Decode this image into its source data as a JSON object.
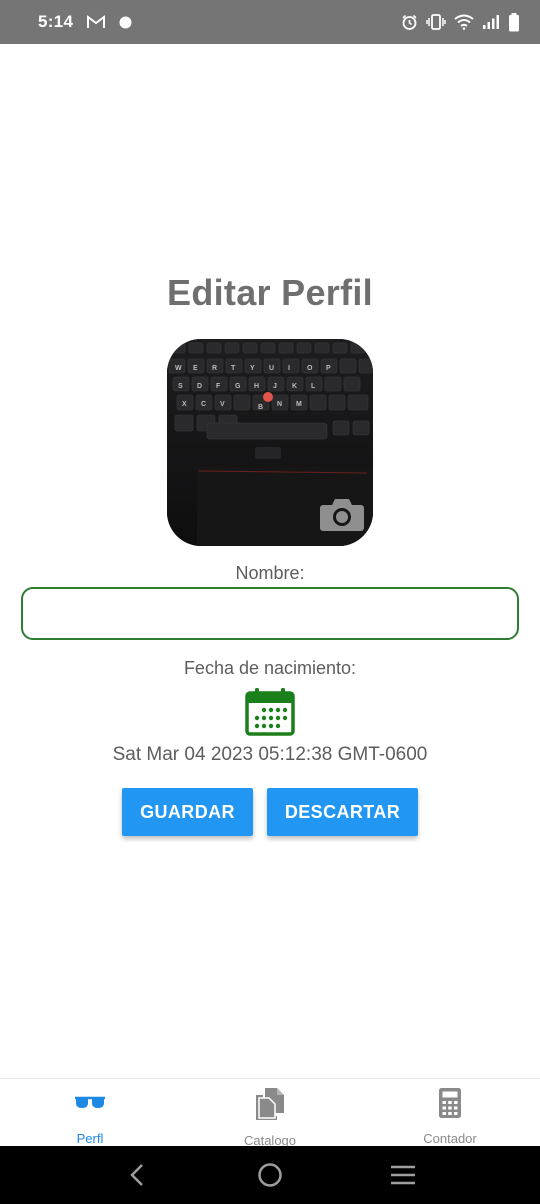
{
  "status_bar": {
    "time": "5:14",
    "left_icons": [
      "gmail-icon",
      "notification-dot-icon"
    ],
    "right_icons": [
      "alarm-icon",
      "vibrate-icon",
      "wifi-icon",
      "signal-icon",
      "battery-icon"
    ]
  },
  "page": {
    "title": "Editar Perfil"
  },
  "avatar": {
    "camera_icon": "camera-icon"
  },
  "form": {
    "name_label": "Nombre:",
    "name_value": "",
    "birth_label": "Fecha de nacimiento:",
    "calendar_icon": "calendar-icon",
    "birth_value": "Sat Mar 04 2023 05:12:38 GMT-0600",
    "save_label": "GUARDAR",
    "discard_label": "DESCARTAR"
  },
  "bottom_nav": {
    "items": [
      {
        "label": "Perfl",
        "icon": "sunglasses-icon",
        "active": true
      },
      {
        "label": "Catalogo",
        "icon": "documents-icon",
        "active": false
      },
      {
        "label": "Contador",
        "icon": "calculator-icon",
        "active": false
      }
    ]
  },
  "colors": {
    "accent": "#2196f3",
    "input_border": "#2e7d32",
    "calendar": "#1b7f1b",
    "active_nav": "#1e88e5",
    "status_bar": "#757575"
  }
}
